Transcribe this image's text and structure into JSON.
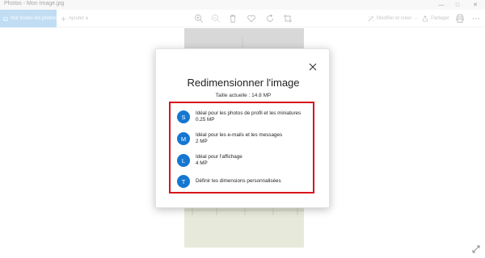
{
  "window": {
    "title": "Photos - Mon Image.jpg",
    "minimize": "—",
    "maximize": "□",
    "close": "✕"
  },
  "toolbar": {
    "see_all_label": "Voir toutes les photos",
    "add_to_label": "Ajouter à",
    "edit_create_label": "Modifier et créer",
    "share_label": "Partager"
  },
  "dialog": {
    "title": "Redimensionner l'image",
    "current_size": "Taille actuelle : 14.8 MP",
    "options": [
      {
        "letter": "S",
        "label": "Idéal pour les photos de profil et les miniatures",
        "size": "0.25 MP"
      },
      {
        "letter": "M",
        "label": "Idéal pour les e-mails et les messages",
        "size": "2 MP"
      },
      {
        "letter": "L",
        "label": "Idéal pour l'affichage",
        "size": "4 MP"
      },
      {
        "letter": "T",
        "label": "Définir les dimensions personnalisées",
        "size": ""
      }
    ]
  },
  "colors": {
    "accent": "#1677d1",
    "highlight": "#d8141c",
    "see_all_bg": "#8ec1ec"
  }
}
